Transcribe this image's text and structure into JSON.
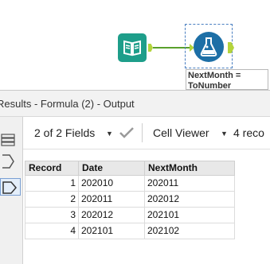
{
  "canvas": {
    "input_tool": {
      "icon": "book-icon",
      "color": "#1e9e8a"
    },
    "formula_tool": {
      "icon": "flask-icon",
      "color": "#1d6fa6"
    },
    "annotation": "NextMonth = ToNumber"
  },
  "results": {
    "title": "Results - Formula (2) - Output",
    "toolbar": {
      "fields_selector": "2 of 2 Fields",
      "viewer_selector": "Cell Viewer",
      "records_label": "4 reco"
    },
    "table": {
      "headers": [
        "Record",
        "Date",
        "NextMonth"
      ],
      "rows": [
        {
          "record": "1",
          "date": "202010",
          "next": "202011"
        },
        {
          "record": "2",
          "date": "202011",
          "next": "202012"
        },
        {
          "record": "3",
          "date": "202012",
          "next": "202101"
        },
        {
          "record": "4",
          "date": "202101",
          "next": "202102"
        }
      ]
    }
  },
  "colors": {
    "anchor": "#b4d43c",
    "connection": "#5aa02c",
    "selection": "#4a7fc1"
  }
}
